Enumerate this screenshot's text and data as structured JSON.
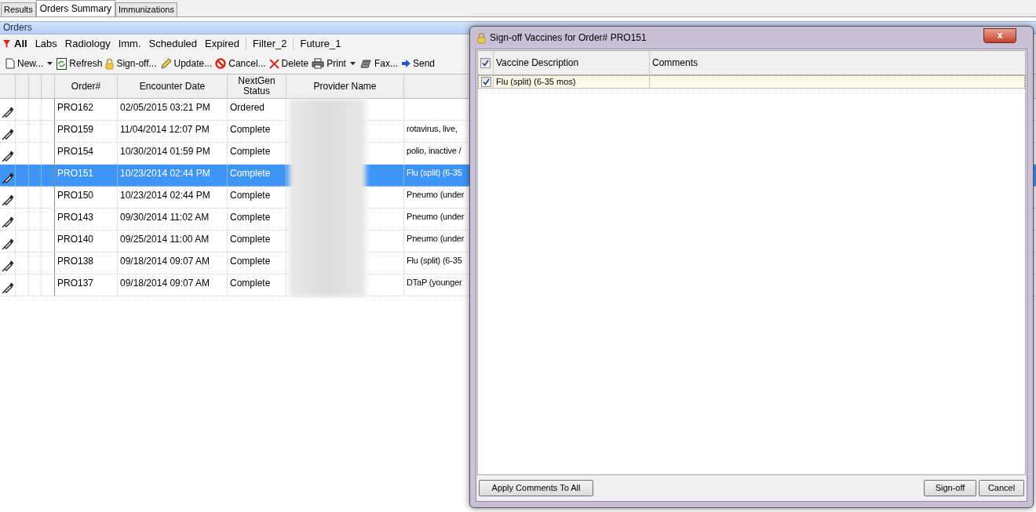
{
  "tabs": [
    {
      "label": "Results",
      "selected": false
    },
    {
      "label": "Orders Summary",
      "selected": true
    },
    {
      "label": "Immunizations",
      "selected": false
    }
  ],
  "panel_title": "Orders",
  "filters": [
    {
      "label": "All",
      "selected": true
    },
    {
      "label": "Labs",
      "selected": false
    },
    {
      "label": "Radiology",
      "selected": false
    },
    {
      "label": "Imm.",
      "selected": false
    },
    {
      "label": "Scheduled",
      "selected": false
    },
    {
      "label": "Expired",
      "selected": false
    },
    {
      "label": "Filter_2",
      "selected": false
    },
    {
      "label": "Future_1",
      "selected": false
    }
  ],
  "toolbar": [
    {
      "kind": "new",
      "label": "New...",
      "dropdown": true
    },
    {
      "kind": "refresh",
      "label": "Refresh",
      "dropdown": false
    },
    {
      "kind": "signoff",
      "label": "Sign-off...",
      "dropdown": false
    },
    {
      "kind": "update",
      "label": "Update...",
      "dropdown": false
    },
    {
      "kind": "cancel",
      "label": "Cancel...",
      "dropdown": false
    },
    {
      "kind": "delete",
      "label": "Delete",
      "dropdown": false
    },
    {
      "kind": "print",
      "label": "Print",
      "dropdown": true
    },
    {
      "kind": "fax",
      "label": "Fax...",
      "dropdown": false
    },
    {
      "kind": "send",
      "label": "Send",
      "dropdown": false
    }
  ],
  "table": {
    "columns": [
      "Order#",
      "Encounter Date",
      "NextGen Status",
      "Provider Name"
    ],
    "rows": [
      {
        "order": "PRO162",
        "date": "02/05/2015 03:21 PM",
        "status": "Ordered",
        "description": "",
        "selected": false
      },
      {
        "order": "PRO159",
        "date": "11/04/2014 12:07 PM",
        "status": "Complete",
        "description": "rotavirus, live,",
        "selected": false
      },
      {
        "order": "PRO154",
        "date": "10/30/2014 01:59 PM",
        "status": "Complete",
        "description": "polio, inactive /",
        "selected": false
      },
      {
        "order": "PRO151",
        "date": "10/23/2014 02:44 PM",
        "status": "Complete",
        "description": "Flu (split) (6-35",
        "selected": true
      },
      {
        "order": "PRO150",
        "date": "10/23/2014 02:44 PM",
        "status": "Complete",
        "description": "Pneumo (under",
        "selected": false
      },
      {
        "order": "PRO143",
        "date": "09/30/2014 11:02 AM",
        "status": "Complete",
        "description": "Pneumo (under",
        "selected": false
      },
      {
        "order": "PRO140",
        "date": "09/25/2014 11:00 AM",
        "status": "Complete",
        "description": "Pneumo (under",
        "selected": false
      },
      {
        "order": "PRO138",
        "date": "09/18/2014 09:07 AM",
        "status": "Complete",
        "description": "Flu (split) (6-35",
        "selected": false
      },
      {
        "order": "PRO137",
        "date": "09/18/2014 09:07 AM",
        "status": "Complete",
        "description": "DTaP (younger",
        "selected": false
      }
    ]
  },
  "dialog": {
    "title": "Sign-off Vaccines for Order# PRO151",
    "close": "x",
    "header_checked": true,
    "columns": [
      "Vaccine Description",
      "Comments"
    ],
    "rows": [
      {
        "description": "Flu (split) (6-35 mos)",
        "comments": "",
        "checked": true
      }
    ],
    "buttons": {
      "left": "Apply Comments To All",
      "sign_off": "Sign-off",
      "cancel": "Cancel"
    }
  }
}
